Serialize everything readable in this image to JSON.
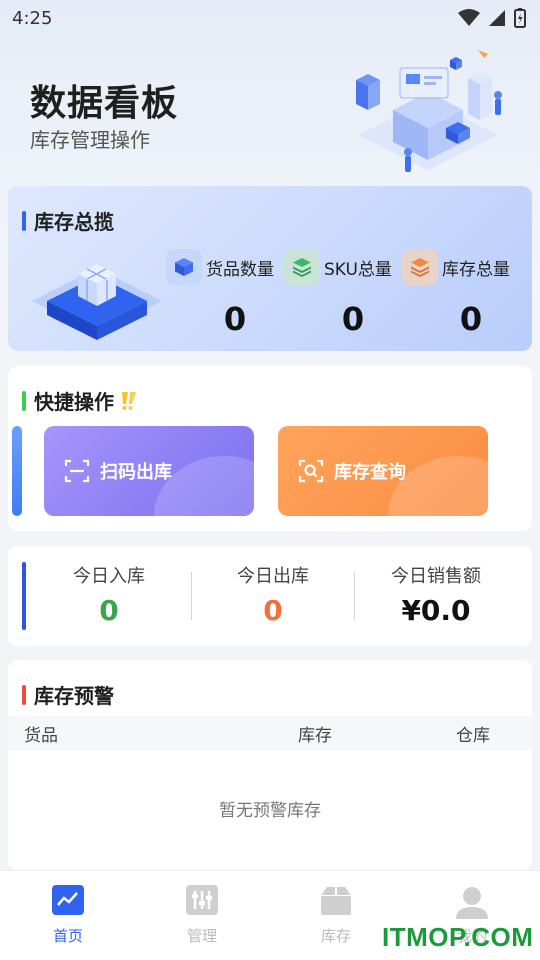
{
  "status_bar": {
    "time": "4:25"
  },
  "header": {
    "title": "数据看板",
    "subtitle": "库存管理操作"
  },
  "overview": {
    "title": "库存总揽",
    "stats": [
      {
        "label": "货品数量",
        "value": "0",
        "icon": "cube-icon",
        "color": "#3e6cf2"
      },
      {
        "label": "SKU总量",
        "value": "0",
        "icon": "layers-icon",
        "color": "#3cb86a"
      },
      {
        "label": "库存总量",
        "value": "0",
        "icon": "stack-icon",
        "color": "#f08a3c"
      }
    ]
  },
  "quick_actions": {
    "title": "快捷操作",
    "buttons": [
      {
        "label": "扫码出库",
        "icon": "scan-icon",
        "color": "#7b6ff0"
      },
      {
        "label": "库存查询",
        "icon": "search-scan-icon",
        "color": "#fb8c42"
      }
    ]
  },
  "today": {
    "items": [
      {
        "label": "今日入库",
        "value": "0",
        "color": "#3aa54a"
      },
      {
        "label": "今日出库",
        "value": "0",
        "color": "#f2703a"
      },
      {
        "label": "今日销售额",
        "value": "¥0.0",
        "color": "#111111"
      }
    ]
  },
  "warning": {
    "title": "库存预警",
    "columns": [
      "货品",
      "库存",
      "仓库"
    ],
    "empty_text": "暂无预警库存"
  },
  "tabbar": {
    "tabs": [
      {
        "label": "首页",
        "icon": "chart-icon",
        "active": true
      },
      {
        "label": "管理",
        "icon": "sliders-icon",
        "active": false
      },
      {
        "label": "库存",
        "icon": "box-icon",
        "active": false
      },
      {
        "label": "我的",
        "icon": "user-icon",
        "active": false
      }
    ]
  },
  "watermark": "ITMOP.COM"
}
